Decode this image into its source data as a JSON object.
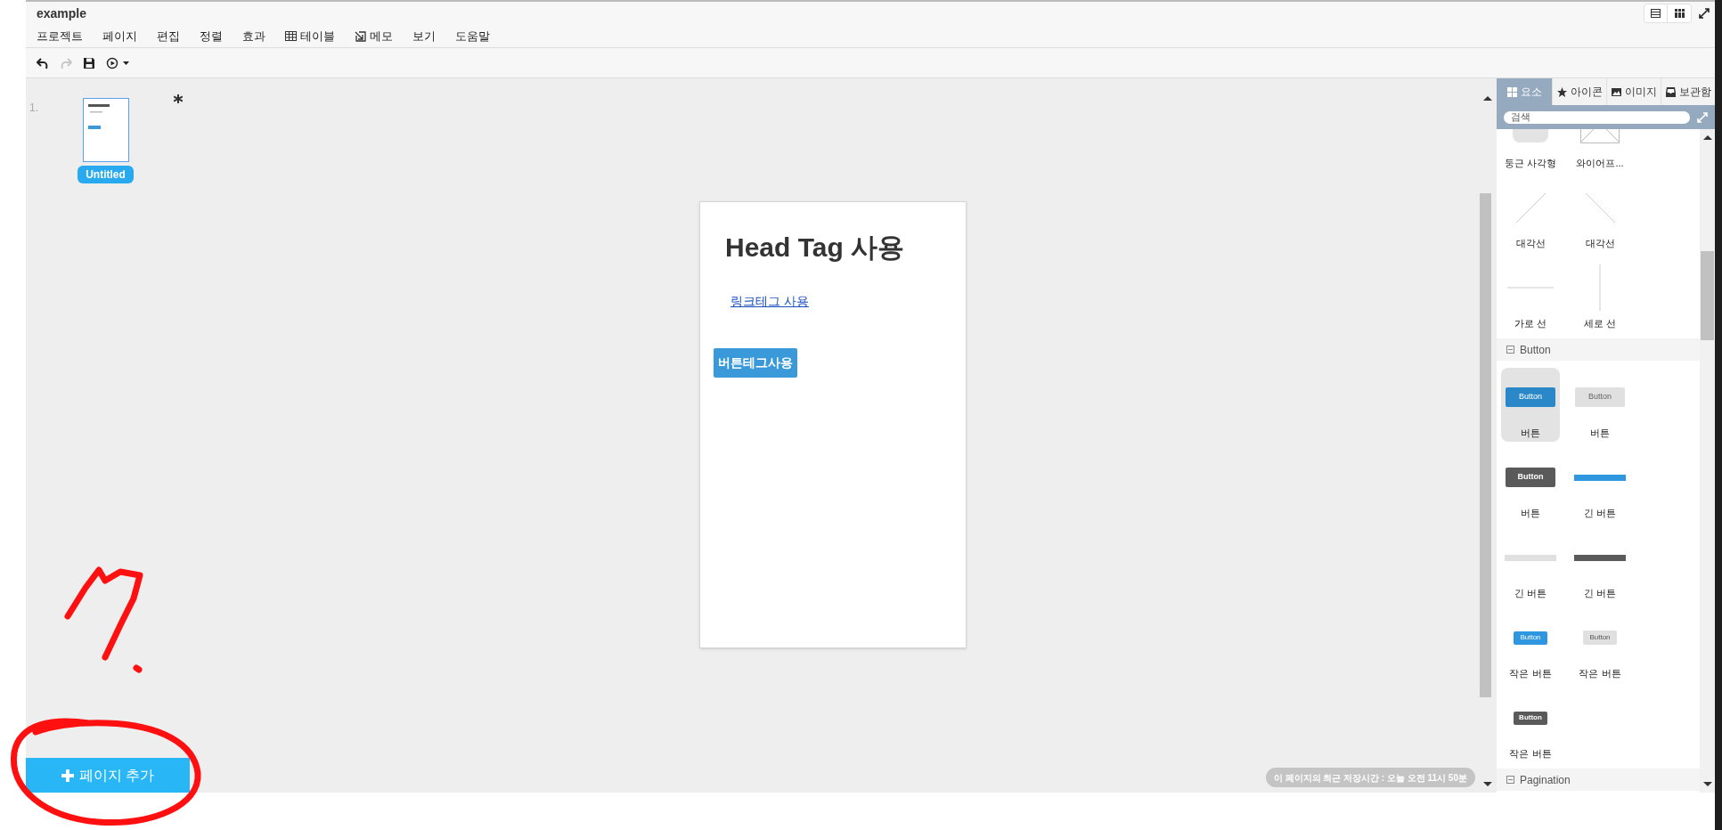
{
  "window": {
    "title": "example"
  },
  "menu": [
    {
      "label": "프로젝트",
      "kind": "text"
    },
    {
      "label": "페이지",
      "kind": "text"
    },
    {
      "label": "편집",
      "kind": "text"
    },
    {
      "label": "정렬",
      "kind": "text"
    },
    {
      "label": "효과",
      "kind": "text"
    },
    {
      "label": "테이블",
      "kind": "table"
    },
    {
      "label": "메모",
      "kind": "memo"
    },
    {
      "label": "보기",
      "kind": "text"
    },
    {
      "label": "도움말",
      "kind": "text"
    }
  ],
  "toolbar": [
    {
      "kind": "undo",
      "disabled": false
    },
    {
      "kind": "redo",
      "disabled": true
    },
    {
      "kind": "save",
      "disabled": false
    },
    {
      "kind": "preview",
      "disabled": false
    }
  ],
  "pages": [
    {
      "number": "1.",
      "title": "Untitled",
      "selected": true
    }
  ],
  "canvas": {
    "heading": "Head Tag 사용",
    "link": "링크테그 사용",
    "button": "버튼테그사용"
  },
  "add_page_button": "페이지 추가",
  "save_status": "이 페이지의 최근 저장시간 : 오늘 오전 11시 50분",
  "panel": {
    "tabs": [
      {
        "label": "요소",
        "kind": "elements",
        "selected": true
      },
      {
        "label": "아이콘",
        "kind": "icons",
        "selected": false
      },
      {
        "label": "이미지",
        "kind": "images",
        "selected": false
      },
      {
        "label": "보관함",
        "kind": "storage",
        "selected": false
      }
    ],
    "search": {
      "placeholder": "검색"
    },
    "sections": [
      {
        "items": [
          {
            "label": "둥근 사각형",
            "kind": "rounded-rect",
            "selected": false
          },
          {
            "label": "와이어프...",
            "kind": "wireframe",
            "selected": false
          },
          {
            "label": "대각선",
            "kind": "diagonal-up",
            "selected": false
          },
          {
            "label": "대각선",
            "kind": "diagonal-down",
            "selected": false
          },
          {
            "label": "가로 선",
            "kind": "horizontal-line",
            "selected": false
          },
          {
            "label": "세로 선",
            "kind": "vertical-line",
            "selected": false
          }
        ]
      },
      {
        "title": "Button",
        "items": [
          {
            "label": "버튼",
            "kind": "button-blue",
            "preview_text": "Button",
            "selected": true
          },
          {
            "label": "버튼",
            "kind": "button-gray",
            "preview_text": "Button",
            "selected": false
          },
          {
            "label": "버튼",
            "kind": "button-dark",
            "preview_text": "Button",
            "selected": false
          },
          {
            "label": "긴 버튼",
            "kind": "long-blue",
            "selected": false
          },
          {
            "label": "긴 버튼",
            "kind": "long-gray",
            "selected": false
          },
          {
            "label": "긴 버튼",
            "kind": "long-dark",
            "selected": false
          },
          {
            "label": "작은 버튼",
            "kind": "small-blue",
            "preview_text": "Button",
            "selected": false
          },
          {
            "label": "작은 버튼",
            "kind": "small-gray",
            "preview_text": "Button",
            "selected": false
          },
          {
            "label": "작은 버튼",
            "kind": "small-dark",
            "preview_text": "Button",
            "selected": false
          }
        ]
      },
      {
        "title": "Pagination"
      }
    ]
  }
}
